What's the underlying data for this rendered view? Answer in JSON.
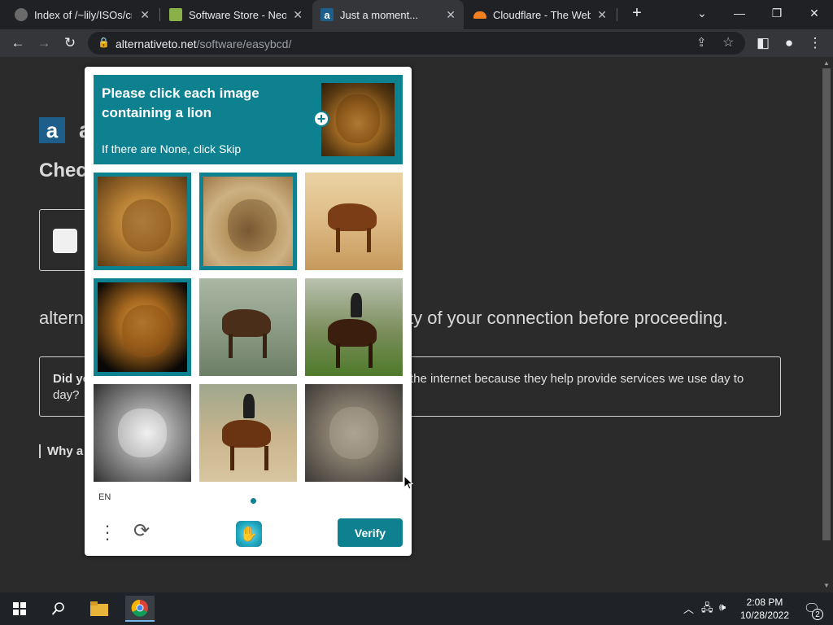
{
  "tabs": [
    {
      "title": "Index of /~lily/ISOs/cru",
      "favicon_color": "#6a6a6a"
    },
    {
      "title": "Software Store - NeoSm",
      "favicon_color": "#8ab04a"
    },
    {
      "title": "Just a moment...",
      "favicon_color": "#1d5f8a",
      "active": true
    },
    {
      "title": "Cloudflare - The Web P",
      "favicon_color": "#f38020"
    }
  ],
  "toolbar": {
    "url_domain": "alternativeto.net",
    "url_path": "/software/easybcd/"
  },
  "page": {
    "logo_letter": "a",
    "logo_text": "a",
    "heading": "Check",
    "verify_text_start": "altern",
    "verify_text_end": "ty of your connection before proceeding.",
    "info_lead": "Did yo",
    "info_lead2": "day?",
    "info_rest": "the internet because they help provide services we use day to",
    "why_text": "Why a"
  },
  "captcha": {
    "prompt": "Please click each image containing a lion",
    "hint": "If there are None, click Skip",
    "lang": "EN",
    "verify_label": "Verify",
    "accent": "#0e8191",
    "cells": [
      {
        "subject": "lion",
        "selected": true
      },
      {
        "subject": "lion",
        "selected": true
      },
      {
        "subject": "horse",
        "selected": false
      },
      {
        "subject": "lion",
        "selected": true
      },
      {
        "subject": "horse",
        "selected": false
      },
      {
        "subject": "horse with rider",
        "selected": false
      },
      {
        "subject": "cat",
        "selected": false
      },
      {
        "subject": "horse with rider",
        "selected": false
      },
      {
        "subject": "lion",
        "selected": false
      }
    ]
  },
  "taskbar": {
    "time": "2:08 PM",
    "date": "10/28/2022",
    "notification_count": "2"
  }
}
